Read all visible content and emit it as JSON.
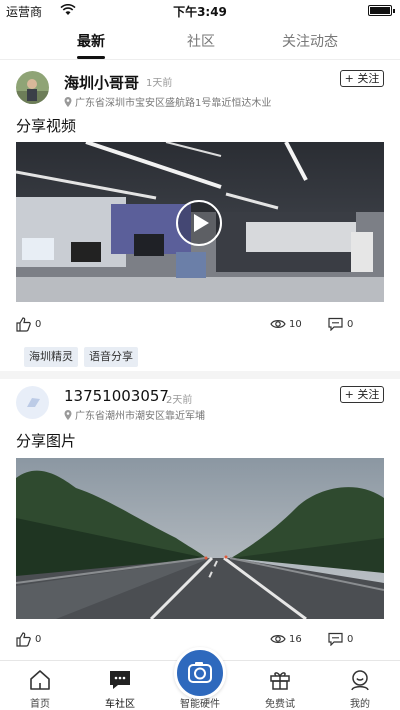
{
  "status_bar": {
    "carrier": "运营商",
    "time": "下午3:49"
  },
  "top_tabs": [
    {
      "label": "最新"
    },
    {
      "label": "社区"
    },
    {
      "label": "关注动态"
    }
  ],
  "posts": [
    {
      "username": "海圳小哥哥",
      "time": "1天前",
      "location": "广东省深圳市宝安区盛航路1号靠近恒达木业",
      "follow_label": "+ 关注",
      "title": "分享视频",
      "media_type": "video",
      "likes": "0",
      "views": "10",
      "comments": "0",
      "tags": [
        "海圳精灵",
        "语音分享"
      ]
    },
    {
      "username": "13751003057",
      "time": "2天前",
      "location": "广东省潮州市潮安区靠近军埔",
      "follow_label": "+ 关注",
      "title": "分享图片",
      "media_type": "image",
      "likes": "0",
      "views": "16",
      "comments": "0"
    }
  ],
  "bottom_nav": [
    {
      "label": "首页",
      "icon": "home-icon"
    },
    {
      "label": "车社区",
      "icon": "chat-icon"
    },
    {
      "label": "智能硬件",
      "icon": "camera-icon"
    },
    {
      "label": "免费试",
      "icon": "gift-icon"
    },
    {
      "label": "我的",
      "icon": "user-icon"
    }
  ],
  "colors": {
    "accent": "#2e69bd",
    "tag_bg": "#e8edf4"
  }
}
